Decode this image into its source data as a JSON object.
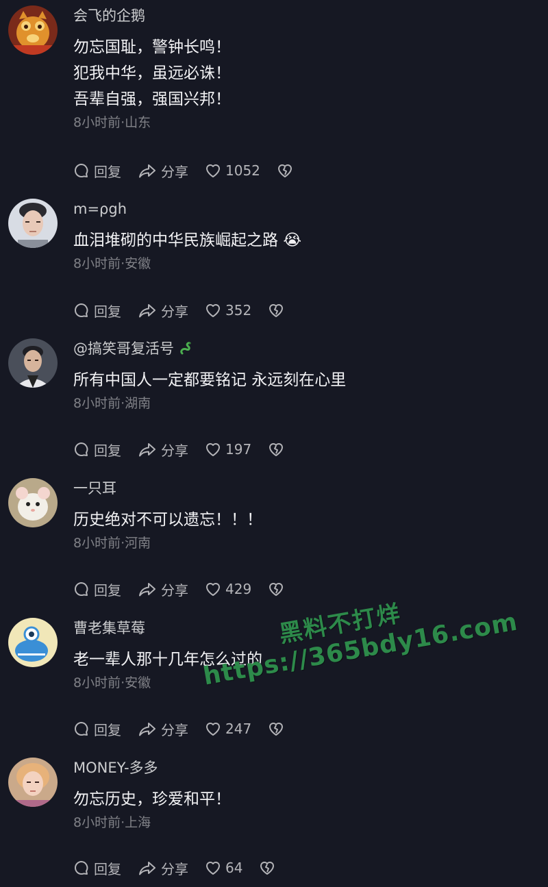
{
  "comments": [
    {
      "username": "会飞的企鹅",
      "lines": [
        "勿忘国耻，警钟长鸣！",
        "犯我中华，虽远必诛！",
        "吾辈自强，强国兴邦！"
      ],
      "meta": "8小时前·山东",
      "reply_label": "回复",
      "share_label": "分享",
      "likes": "1052",
      "avatar_icon": "cartoon-cat-avatar"
    },
    {
      "username": "m=ρgh",
      "lines": [
        "血泪堆砌的中华民族崛起之路 😭"
      ],
      "meta": "8小时前·安徽",
      "reply_label": "回复",
      "share_label": "分享",
      "likes": "352",
      "avatar_icon": "person-photo-avatar"
    },
    {
      "username": "@搞笑哥复活号",
      "lines": [
        "所有中国人一定都要铭记 永远刻在心里"
      ],
      "meta": "8小时前·湖南",
      "reply_label": "回复",
      "share_label": "分享",
      "likes": "197",
      "avatar_icon": "person-photo-avatar",
      "badge_icon": "snake-badge-icon"
    },
    {
      "username": "一只耳",
      "lines": [
        "历史绝对不可以遗忘！！！"
      ],
      "meta": "8小时前·河南",
      "reply_label": "回复",
      "share_label": "分享",
      "likes": "429",
      "avatar_icon": "mouse-photo-avatar"
    },
    {
      "username": "曹老集草莓",
      "lines": [
        "老一辈人那十几年怎么过的"
      ],
      "meta": "8小时前·安徽",
      "reply_label": "回复",
      "share_label": "分享",
      "likes": "247",
      "avatar_icon": "cartoon-alien-avatar"
    },
    {
      "username": "MONEY-多多",
      "lines": [
        "勿忘历史，珍爱和平！"
      ],
      "meta": "8小时前·上海",
      "reply_label": "回复",
      "share_label": "分享",
      "likes": "64",
      "avatar_icon": "person-photo-avatar"
    }
  ],
  "watermark": {
    "line1": "黑料不打烊",
    "line2": "https://365bdy16.com",
    "color": "#2d8a4a"
  },
  "colors": {
    "background": "#161823",
    "text": "#f2f2f4"
  }
}
